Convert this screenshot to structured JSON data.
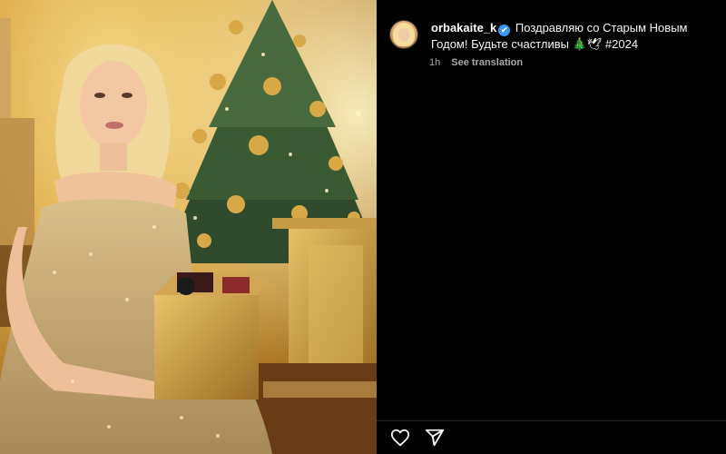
{
  "post": {
    "username": "orbakaite_k",
    "verified_badge": "✔",
    "caption": "Поздравляю со Старым Новым Годом! Будьте счастливы 🎄🕊 #2024",
    "time_ago": "1h",
    "see_translation": "See translation"
  },
  "icons": {
    "like": "heart-icon",
    "share": "share-icon",
    "verified": "verified-badge-icon"
  },
  "colors": {
    "background": "#000000",
    "text": "#f5f5f5",
    "muted": "#a8a8a8",
    "verified": "#3897f0"
  }
}
